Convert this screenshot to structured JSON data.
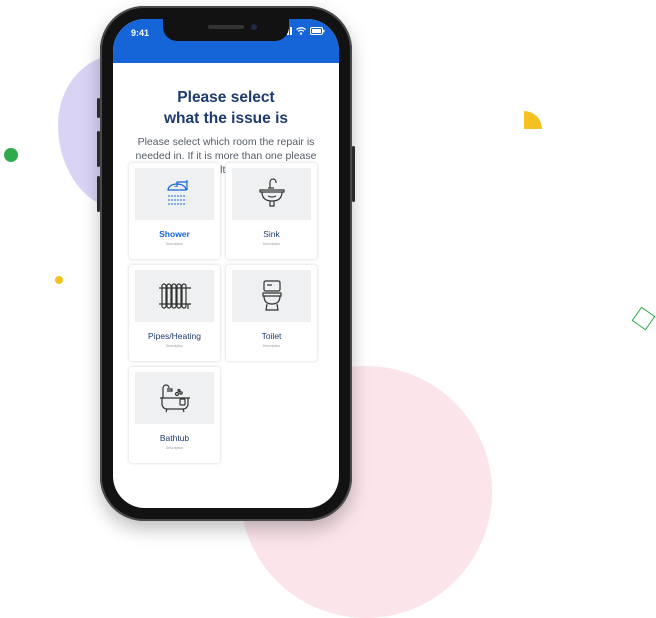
{
  "status_bar": {
    "time": "9:41",
    "icons": [
      "signal-icon",
      "wifi-icon",
      "battery-icon"
    ],
    "background": "#1565d8"
  },
  "page": {
    "title_line1": "Please select",
    "title_line2": "what the issue is",
    "subtitle": "Please select which room the repair is needed in. If it is more than one please select multiple rooms."
  },
  "options": [
    {
      "label": "Shower",
      "description": "Description",
      "icon": "shower-icon",
      "selected": true
    },
    {
      "label": "Sink",
      "description": "Description",
      "icon": "sink-icon",
      "selected": false
    },
    {
      "label": "Pipes/Heating",
      "description": "Description",
      "icon": "radiator-icon",
      "selected": false
    },
    {
      "label": "Toilet",
      "description": "Description",
      "icon": "toilet-icon",
      "selected": false
    },
    {
      "label": "Bathtub",
      "description": "Description",
      "icon": "bathtub-icon",
      "selected": false
    }
  ],
  "colors": {
    "accent": "#1565d8",
    "title": "#1d3b6e",
    "decor_purple": "#d9d3f5",
    "decor_pink": "#fbe4ea",
    "decor_green": "#2eaa4a",
    "decor_yellow": "#f5c120"
  }
}
